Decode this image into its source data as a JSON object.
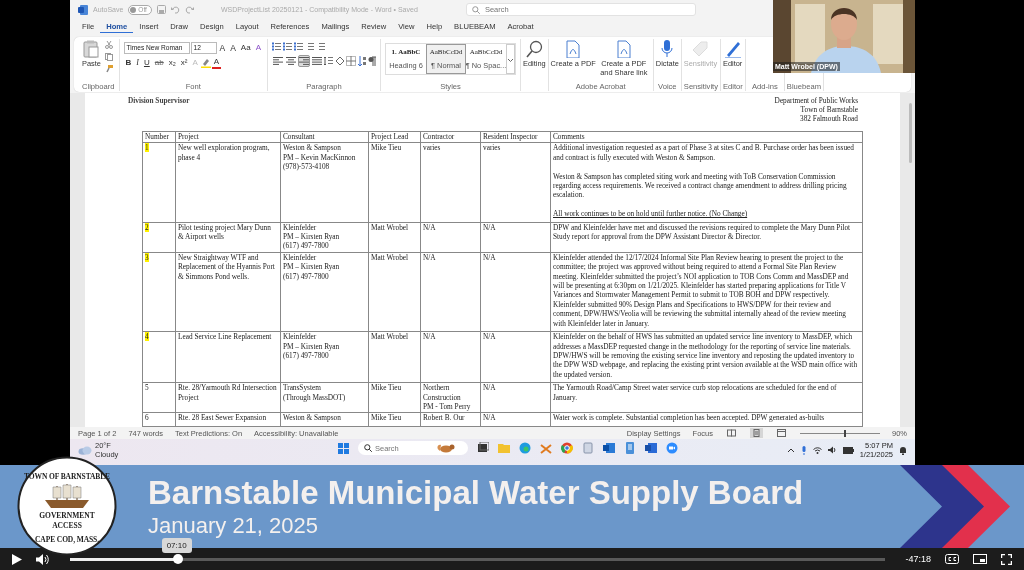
{
  "word": {
    "title_bar": {
      "autosave": {
        "label": "AutoSave",
        "state": "Off",
        "on": false
      },
      "document_title": "WSDProjectList 20250121 - Compatibility Mode - Word • Saved",
      "search_placeholder": "Search"
    },
    "menu_tabs": [
      {
        "label": "File",
        "selected": false
      },
      {
        "label": "Home",
        "selected": true
      },
      {
        "label": "Insert",
        "selected": false
      },
      {
        "label": "Draw",
        "selected": false
      },
      {
        "label": "Design",
        "selected": false
      },
      {
        "label": "Layout",
        "selected": false
      },
      {
        "label": "References",
        "selected": false
      },
      {
        "label": "Mailings",
        "selected": false
      },
      {
        "label": "Review",
        "selected": false
      },
      {
        "label": "View",
        "selected": false
      },
      {
        "label": "Help",
        "selected": false
      },
      {
        "label": "BLUEBEAM",
        "selected": false
      },
      {
        "label": "Acrobat",
        "selected": false
      }
    ],
    "ribbon": {
      "clipboard": {
        "paste_label": "Paste",
        "label": "Clipboard"
      },
      "font": {
        "font_name": "Times New Roman",
        "font_size": "12",
        "row1": [
          {
            "label": "A",
            "kind": "grow"
          },
          {
            "label": "A",
            "kind": "shrink"
          },
          {
            "label": "Aa",
            "kind": "case"
          },
          {
            "label": "A",
            "kind": "clear"
          }
        ],
        "row2": [
          {
            "label": "B",
            "kind": "bold"
          },
          {
            "label": "I",
            "kind": "italic"
          },
          {
            "label": "U",
            "kind": "underline"
          },
          {
            "label": "ab",
            "kind": "strike"
          },
          {
            "label": "x₂",
            "kind": "plain"
          },
          {
            "label": "x²",
            "kind": "plain"
          },
          {
            "label": "A",
            "kind": "effects"
          },
          {
            "label": "A",
            "kind": "color"
          }
        ],
        "label": "Font"
      },
      "paragraph": {
        "alignments": [
          {
            "kind": "left",
            "selected": false
          },
          {
            "kind": "center",
            "selected": false
          },
          {
            "kind": "right",
            "selected": true
          },
          {
            "kind": "justify",
            "selected": false
          }
        ],
        "label": "Paragraph"
      },
      "styles": {
        "cards": [
          {
            "sample": "1.  AaBbC",
            "name": "Heading 6",
            "selected": false,
            "kind": "heading"
          },
          {
            "sample": "AaBbCcDd",
            "name": "¶ Normal",
            "selected": true,
            "kind": "body"
          },
          {
            "sample": "AaBbCcDd",
            "name": "¶ No Spac...",
            "selected": false,
            "kind": "body"
          }
        ],
        "label": "Styles"
      },
      "big_groups": [
        {
          "buttons": [
            {
              "label": "Editing",
              "kind": "search",
              "disabled": false
            }
          ]
        },
        {
          "label": "Adobe Acrobat",
          "buttons": [
            {
              "label": "Create a PDF",
              "kind": "pdf",
              "disabled": false
            },
            {
              "label": "Create a PDF and Share link",
              "kind": "pdf",
              "disabled": false
            }
          ]
        },
        {
          "label": "Voice",
          "buttons": [
            {
              "label": "Dictate",
              "kind": "mic",
              "disabled": false
            }
          ]
        },
        {
          "label": "Sensitivity",
          "buttons": [
            {
              "label": "Sensitivity",
              "kind": "tag",
              "disabled": true
            }
          ]
        },
        {
          "label": "Editor",
          "buttons": [
            {
              "label": "Editor",
              "kind": "pen",
              "disabled": false
            }
          ]
        },
        {
          "label": "Add-ins"
        },
        {
          "label": "Bluebeam"
        }
      ]
    },
    "document": {
      "left_heading": "Division Supervisor",
      "address": [
        "Department of Public Works",
        "Town of Barnstable",
        "382 Falmouth Road"
      ],
      "columns": [
        "Number",
        "Project",
        "Consultant",
        "Project Lead",
        "Contractor",
        "Resident Inspector",
        "Comments"
      ],
      "rows": [
        {
          "number": "1",
          "highlighted": true,
          "project": "New well exploration program, phase 4",
          "consultant": "Weston & Sampson\nPM – Kevin MacKinnon\n(978)-573-4108",
          "lead": "Mike Tieu",
          "contractor": "varies",
          "inspector": "varies",
          "comments": [
            {
              "text": "Additional investigation requested as a part of Phase 3 at sites C and B. Purchase order has been issued and contract is fully executed with Weston & Sampson.",
              "underlined": false
            },
            {
              "text": "Weston & Sampson has completed siting work and meeting with ToB Conservation Commission regarding access requirements. We received a contract change amendment to address drilling pricing escalation.",
              "underlined": false
            },
            {
              "text": "All work continues to be on hold until further notice. (No Change)",
              "underlined": true
            }
          ]
        },
        {
          "number": "2",
          "highlighted": true,
          "project": "Pilot testing project Mary Dunn & Airport wells",
          "consultant": "Kleinfelder\nPM – Kirsten Ryan\n(617) 497-7800",
          "lead": "Matt Wrobel",
          "contractor": "N/A",
          "inspector": "N/A",
          "comments": [
            {
              "text": "DPW and Kleinfelder have met and discussed the revisions required to complete the Mary Dunn Pilot Study report for approval from the DPW Assistant Director & Director.",
              "underlined": false
            }
          ]
        },
        {
          "number": "3",
          "highlighted": true,
          "project": "New Straightway WTF and Replacement of the Hyannis Port & Simmons Pond wells.",
          "consultant": "Kleinfelder\nPM – Kirsten Ryan\n(617) 497-7800",
          "lead": "Matt Wrobel",
          "contractor": "N/A",
          "inspector": "N/A",
          "comments": [
            {
              "text": "Kleinfelder attended the 12/17/2024 Informal Site Plan Review hearing to present the project to the committee; the project was approved without being required to attend a Formal Site Plan Review meeting. Kleinfelder submitted the project’s NOI application to TOB Cons Comm and MassDEP and will be presenting at 6:30pm on 1/21/2025. Kleinfelder has started preparing applications for Title V Variances and Stormwater Management Permit to submit to TOB BOH and DPW respectively. Kleinfelder submitted 90% Design Plans and Specifications to HWS/DPW for their review and comment, DPW/HWS/Veolia will be reviewing the submittal internally ahead of the review meeting with Kleinfelder later in January.",
              "underlined": false
            }
          ]
        },
        {
          "number": "4",
          "highlighted": true,
          "project": "Lead Service Line Replacement",
          "consultant": "Kleinfelder\nPM – Kirsten Ryan\n(617) 497-7800",
          "lead": "Matt Wrobel",
          "contractor": "N/A",
          "inspector": "N/A",
          "comments": [
            {
              "text": "Kleinfelder on the behalf of HWS has submitted an updated service line inventory to MassDEP, which addresses a MassDEP requested change in the methodology for the reporting of service line materials. DPW/HWS will be removing the existing service line inventory and reposting the updated inventory to the DPW WSD webpage, and replacing the existing print version available at the WSD main office with the updated version.",
              "underlined": false
            }
          ]
        },
        {
          "number": "5",
          "highlighted": false,
          "project": "Rte. 28/Yarmouth Rd Intersection Project",
          "consultant": "TransSystem\n(Through MassDOT)",
          "lead": "Mike Tieu",
          "contractor": "Northern Construction\nPM - Tom Perry",
          "inspector": "N/A",
          "comments": [
            {
              "text": "The Yarmouth Road/Camp Street water service curb stop relocations are scheduled for the end of January.",
              "underlined": false
            }
          ]
        },
        {
          "number": "6",
          "highlighted": false,
          "project": "Rte. 28 East Sewer Expansion",
          "consultant": "Weston & Sampson",
          "lead": "Mike Tieu",
          "contractor": "Robert B. Our",
          "inspector": "N/A",
          "comments": [
            {
              "text": "Water work is complete. Substantial completion has been accepted. DPW generated as-builts",
              "underlined": false
            }
          ]
        }
      ]
    },
    "status_bar": {
      "items": [
        "Page 1 of 2",
        "747 words",
        "Text Predictions: On",
        "Accessibility: Unavailable"
      ],
      "display_settings": "Display Settings",
      "focus": "Focus",
      "views": [
        {
          "kind": "read",
          "selected": false
        },
        {
          "kind": "print",
          "selected": true
        },
        {
          "kind": "web",
          "selected": false
        }
      ],
      "zoom": {
        "label": "90%",
        "level": 0.55
      }
    },
    "taskbar": {
      "temperature": "20°F",
      "condition": "Cloudy",
      "search_placeholder": "Search",
      "time": "5:07 PM",
      "date": "1/21/2025"
    }
  },
  "webcam": {
    "name": "Matt Wrobel (DPW)"
  },
  "banner": {
    "seal": {
      "top": "TOWN OF BARNSTABLE",
      "center": [
        "GOVERNMENT",
        "ACCESS"
      ],
      "bottom": "CAPE COD, MASS."
    },
    "title": "Barnstable Municipal Water Supply Board",
    "date": "January 21, 2025"
  },
  "player": {
    "playing": false,
    "level": 0.132,
    "tooltip": "07:10",
    "remaining": "-47:18"
  }
}
